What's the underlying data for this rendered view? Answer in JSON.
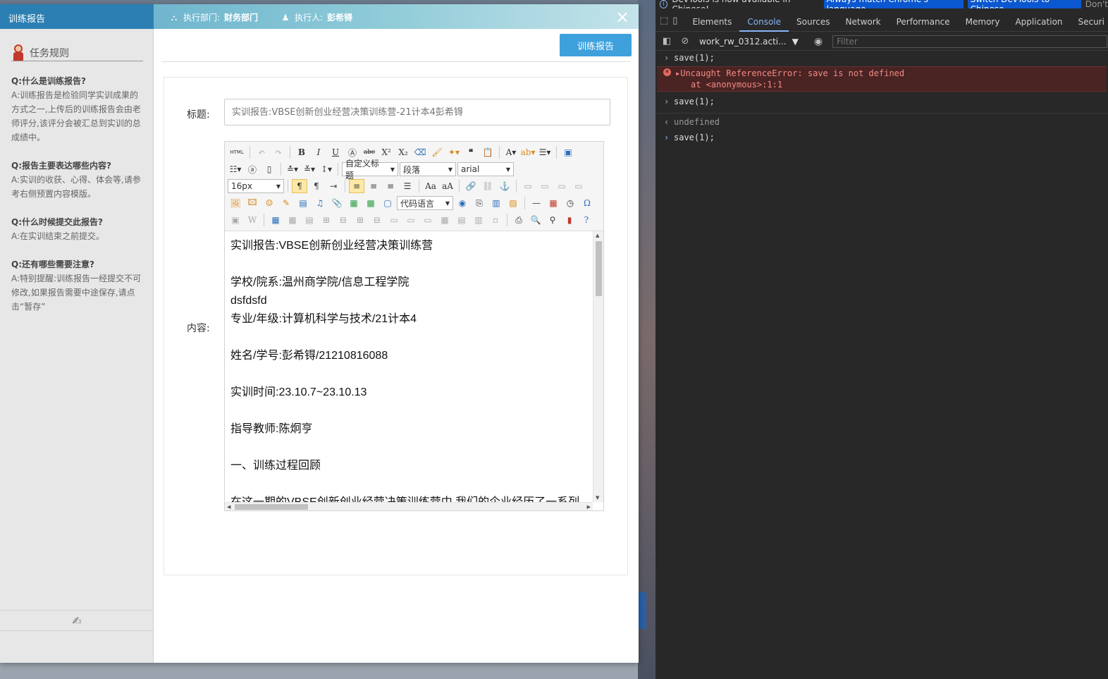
{
  "modal": {
    "tab_title": "训练报告",
    "dept_label": "执行部门:",
    "dept_value": "财务部门",
    "executor_label": "执行人:",
    "executor_value": "彭希锝",
    "close_symbol": "×"
  },
  "sidebar": {
    "rules_title": "任务规则",
    "faq": [
      {
        "q": "Q:什么是训练报告?",
        "a": "A:训练报告是检验同学实训成果的方式之一,上传后的训练报告会由老师评分,该评分会被汇总到实训的总成绩中。"
      },
      {
        "q": "Q:报告主要表达哪些内容?",
        "a": "A:实训的收获、心得、体会等,请参考右侧预置内容模版。"
      },
      {
        "q": "Q:什么时候提交此报告?",
        "a": "A:在实训结束之前提交。"
      },
      {
        "q": "Q:还有哪些需要注意?",
        "a": "A:特别提醒:训练报告一经提交不可修改,如果报告需要中途保存,请点击“暂存”"
      }
    ]
  },
  "main": {
    "report_button": "训练报告",
    "title_label": "标题:",
    "title_placeholder": "实训报告:VBSE创新创业经营决策训练营-21计本4彭希锝",
    "content_label": "内容:"
  },
  "toolbar": {
    "custom_heading": "自定义标题",
    "paragraph": "段落",
    "font_family": "arial",
    "font_size": "16px",
    "code_lang": "代码语言",
    "html_label": "HTML"
  },
  "editor_content": {
    "line1": "实训报告:VBSE创新创业经营决策训练营",
    "line2": "学校/院系:温州商学院/信息工程学院",
    "line3": "dsfdsfd",
    "line4": "专业/年级:计算机科学与技术/21计本4",
    "line5": "姓名/学号:彭希锝/21210816088",
    "line6": "实训时间:23.10.7~23.10.13",
    "line7": "指导教师:陈炯亨",
    "line8": "一、训练过程回顾",
    "line9": "在这一期的VBSE创新创业经营决策训练营中,我们的企业经历了一系列"
  },
  "devtools": {
    "notice": "DevTools is now available in Chinese!",
    "btn_match": "Always match Chrome's language",
    "btn_switch": "Switch DevTools to Chinese",
    "btn_dont": "Don't",
    "tabs": [
      "Elements",
      "Console",
      "Sources",
      "Network",
      "Performance",
      "Memory",
      "Application",
      "Securi"
    ],
    "active_tab": "Console",
    "context": "work_rw_0312.acti...",
    "filter_placeholder": "Filter",
    "console": {
      "cmd1": "save(1);",
      "err1": "Uncaught ReferenceError: save is not defined",
      "err2": "at <anonymous>:1:1",
      "cmd2": "save(1);",
      "out": "undefined",
      "cmd3": "save(1);"
    }
  }
}
